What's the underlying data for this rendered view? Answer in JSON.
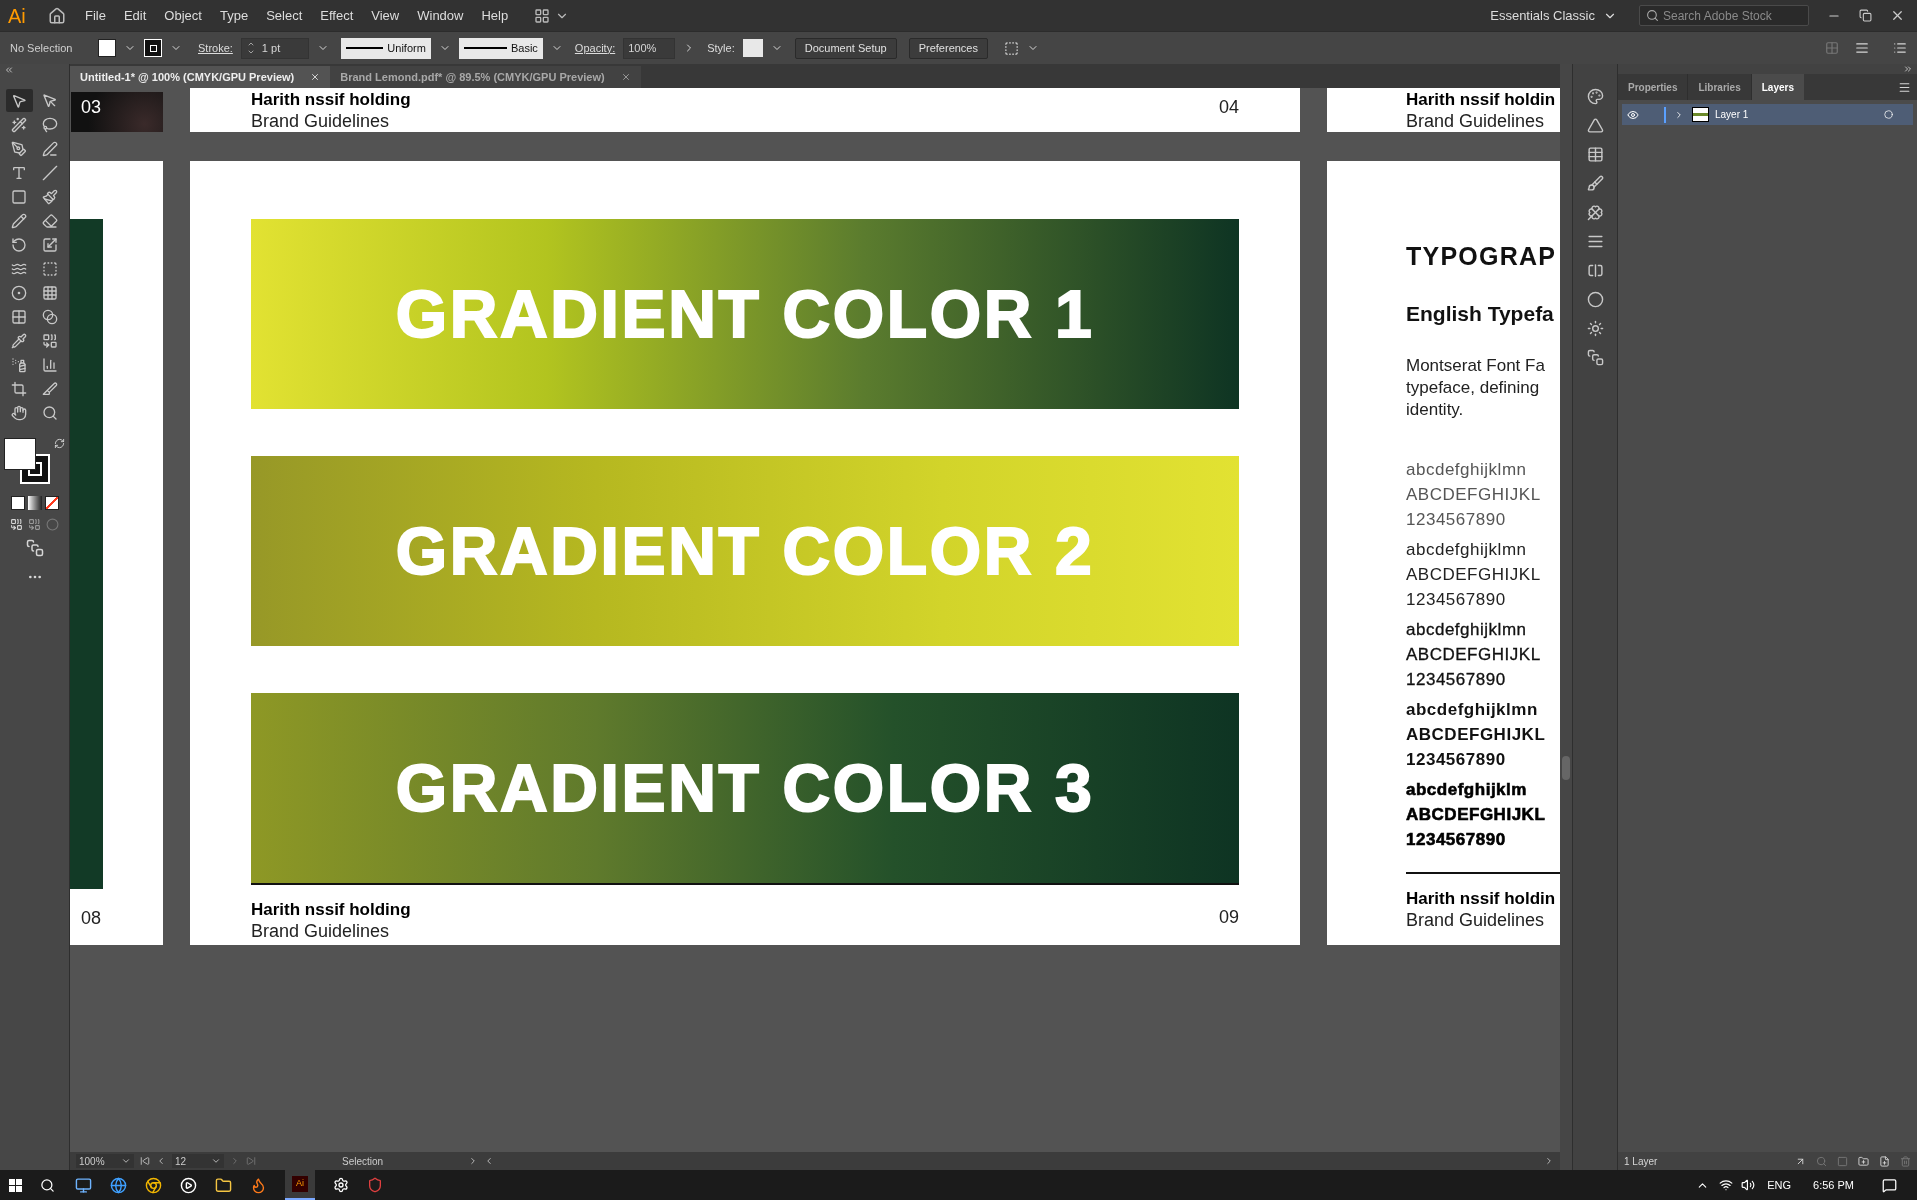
{
  "menu_bar": {
    "logo": "Ai",
    "items": [
      "File",
      "Edit",
      "Object",
      "Type",
      "Select",
      "Effect",
      "View",
      "Window",
      "Help"
    ],
    "workspace": "Essentials Classic",
    "search": {
      "placeholder": "Search Adobe Stock"
    }
  },
  "control_bar": {
    "selection": "No Selection",
    "stroke_label": "Stroke:",
    "stroke_weight": "1 pt",
    "stroke_profile": "Uniform",
    "brush": "Basic",
    "opacity_label": "Opacity:",
    "opacity": "100%",
    "style_label": "Style:",
    "buttons": [
      "Document Setup",
      "Preferences"
    ]
  },
  "tabs": [
    {
      "label": "Untitled-1* @ 100% (CMYK/GPU Preview)",
      "selected": true
    },
    {
      "label": "Brand Lemond.pdf* @ 89.5% (CMYK/GPU Preview)",
      "selected": false
    }
  ],
  "tools": [
    {
      "selected": true
    },
    {
      "selected": false
    },
    {
      "selected": false
    },
    {
      "selected": false
    },
    {
      "selected": false
    },
    {
      "selected": false
    },
    {
      "selected": false
    },
    {
      "selected": false
    },
    {
      "selected": false
    },
    {
      "selected": false
    },
    {
      "selected": false
    },
    {
      "selected": false
    },
    {
      "selected": false
    },
    {
      "selected": false
    },
    {
      "selected": false
    },
    {
      "selected": false
    },
    {
      "selected": false
    },
    {
      "selected": false
    },
    {
      "selected": false
    },
    {
      "selected": false
    },
    {
      "selected": false
    },
    {
      "selected": false
    },
    {
      "selected": false
    },
    {
      "selected": false
    },
    {
      "selected": false
    },
    {
      "selected": false
    },
    {
      "selected": false
    },
    {
      "selected": false
    }
  ],
  "canvas": {
    "top_row": {
      "left_page_number": "03",
      "center": {
        "company": "Harith nssif holding",
        "subtitle": "Brand Guidelines",
        "page_number": "04"
      },
      "right": {
        "company": "Harith nssif holdin",
        "subtitle": "Brand Guidelines"
      }
    },
    "left_page": {
      "page_number": "08"
    },
    "center_page": {
      "bars": [
        {
          "label": "GRADIENT COLOR 1"
        },
        {
          "label": "GRADIENT COLOR 2"
        },
        {
          "label": "GRADIENT COLOR 3"
        }
      ],
      "company": "Harith nssif holding",
      "subtitle": "Brand Guidelines",
      "page_number": "09"
    },
    "right_page": {
      "title": "TYPOGRAP",
      "heading": "English Typefa",
      "paragraph_lines": [
        "Montserat Font Fa",
        "typeface, defining",
        "identity."
      ],
      "specimens": [
        {
          "kind": "light",
          "lines": [
            "abcdefghijklmn",
            "ABCDEFGHIJKL",
            "1234567890"
          ]
        },
        {
          "kind": "regular",
          "lines": [
            "abcdefghijklmn",
            "ABCDEFGHIJKL",
            "1234567890"
          ]
        },
        {
          "kind": "medium",
          "lines": [
            "abcdefghijklmn",
            "ABCDEFGHIJKL",
            "1234567890"
          ]
        },
        {
          "kind": "bold",
          "lines": [
            "abcdefghijklmn",
            "ABCDEFGHIJKL",
            "1234567890"
          ]
        },
        {
          "kind": "black",
          "lines": [
            "abcdefghijklm",
            "ABCDEFGHIJKL",
            "1234567890"
          ]
        }
      ],
      "company": "Harith nssif holdin",
      "subtitle": "Brand Guidelines"
    }
  },
  "status_bar": {
    "zoom": "100%",
    "page": "12",
    "tool": "Selection"
  },
  "layers_panel": {
    "tabs": [
      {
        "label": "Properties",
        "selected": false
      },
      {
        "label": "Libraries",
        "selected": false
      },
      {
        "label": "Layers",
        "selected": true
      }
    ],
    "layers": [
      {
        "name": "Layer 1",
        "visible": true,
        "selected": true,
        "expanded": false
      }
    ],
    "count": "1 Layer"
  },
  "taskbar": {
    "app_label": "Ai",
    "language": "ENG",
    "time": "6:56 PM"
  }
}
